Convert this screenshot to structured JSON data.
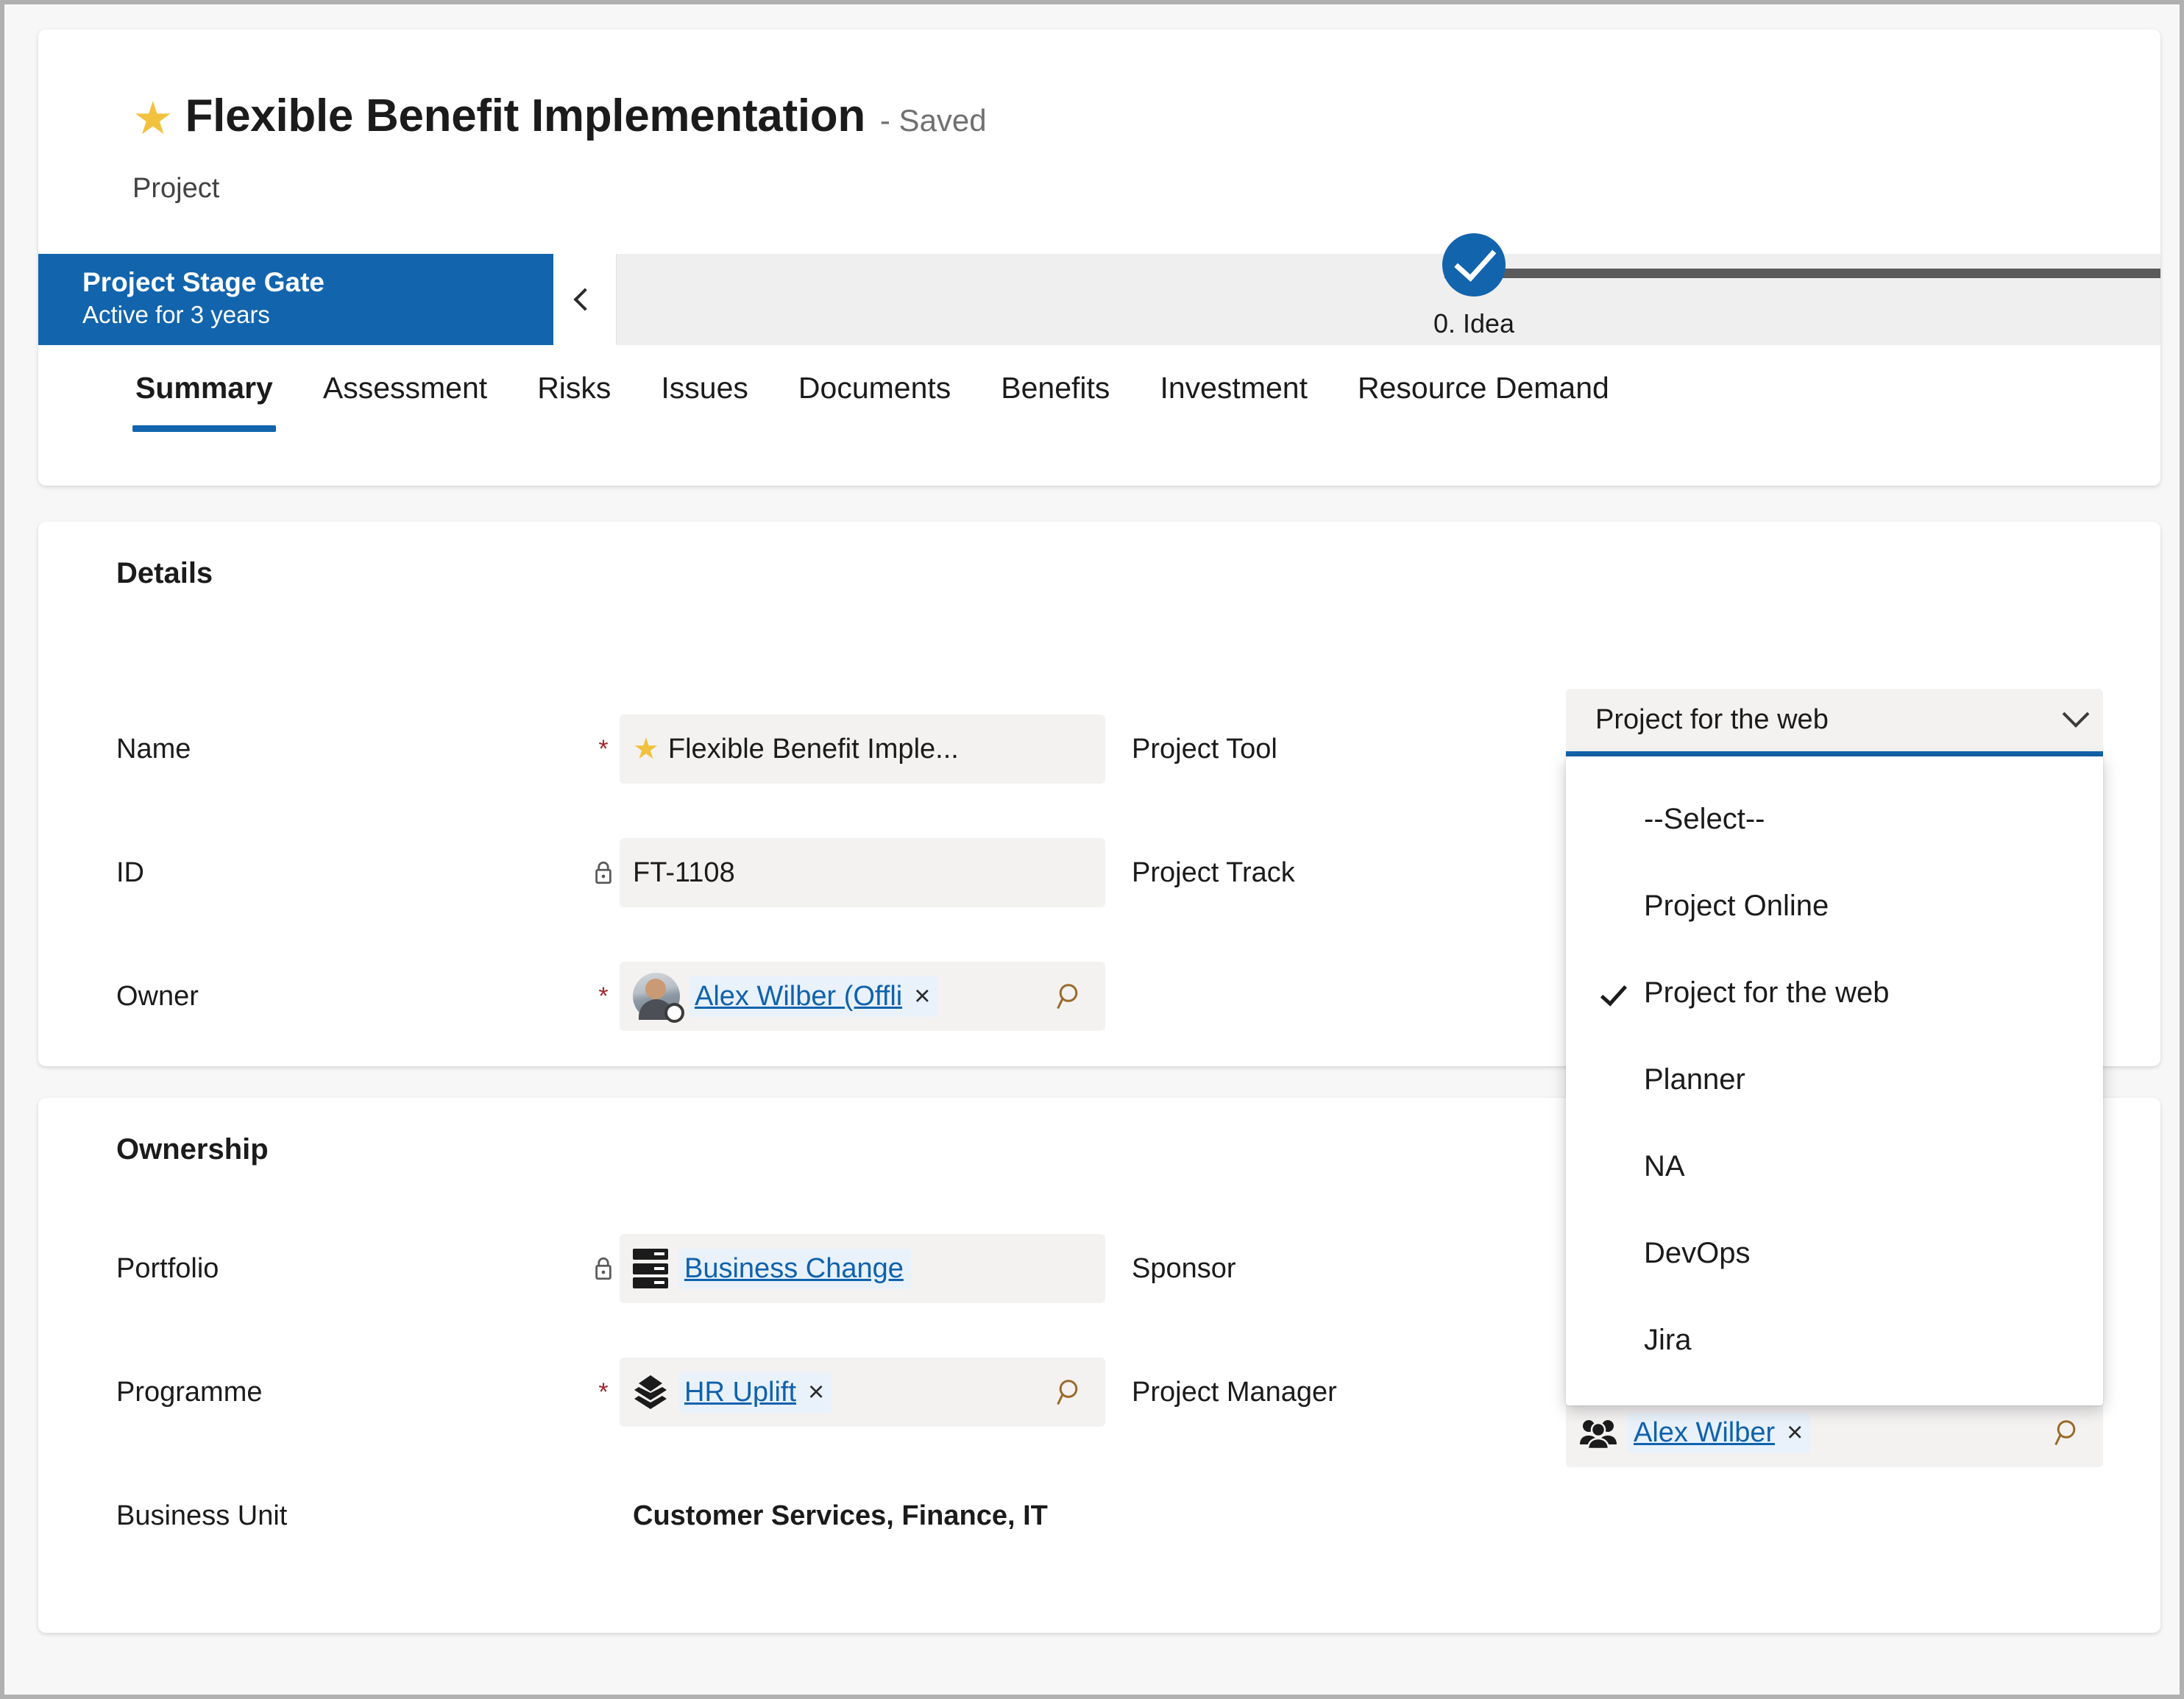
{
  "header": {
    "star_icon": "star-icon",
    "title": "Flexible Benefit Implementation",
    "saved_status": "- Saved",
    "entity_label": "Project"
  },
  "business_process": {
    "name": "Project Stage Gate",
    "active_for": "Active for 3 years",
    "collapse_icon": "chevron-left-icon",
    "stages": [
      {
        "label": "0. Idea",
        "completed": true
      }
    ]
  },
  "tabs": [
    {
      "label": "Summary",
      "active": true
    },
    {
      "label": "Assessment",
      "active": false
    },
    {
      "label": "Risks",
      "active": false
    },
    {
      "label": "Issues",
      "active": false
    },
    {
      "label": "Documents",
      "active": false
    },
    {
      "label": "Benefits",
      "active": false
    },
    {
      "label": "Investment",
      "active": false
    },
    {
      "label": "Resource Demand",
      "active": false
    }
  ],
  "details": {
    "title": "Details",
    "name": {
      "label": "Name",
      "required_marker": "*",
      "value": "Flexible Benefit Imple...",
      "icon": "star-icon"
    },
    "id": {
      "label": "ID",
      "lock_icon": "lock-icon",
      "value": "FT-1108"
    },
    "owner": {
      "label": "Owner",
      "required_marker": "*",
      "value": "Alex Wilber (Offli",
      "remove_label": "×",
      "search_icon": "search-icon",
      "avatar": "avatar"
    },
    "project_tool": {
      "label": "Project Tool",
      "value": "Project for the web",
      "chevron_icon": "chevron-down-icon",
      "options": [
        {
          "label": "--Select--",
          "selected": false
        },
        {
          "label": "Project Online",
          "selected": false
        },
        {
          "label": "Project for the web",
          "selected": true
        },
        {
          "label": "Planner",
          "selected": false
        },
        {
          "label": "NA",
          "selected": false
        },
        {
          "label": "DevOps",
          "selected": false
        },
        {
          "label": "Jira",
          "selected": false
        }
      ]
    },
    "project_track": {
      "label": "Project Track",
      "value": ""
    }
  },
  "ownership": {
    "title": "Ownership",
    "portfolio": {
      "label": "Portfolio",
      "lock_icon": "lock-icon",
      "value": "Business Change",
      "icon": "server-rack-icon"
    },
    "programme": {
      "label": "Programme",
      "required_marker": "*",
      "value": "HR Uplift",
      "remove_label": "×",
      "search_icon": "search-icon",
      "icon": "layers-icon"
    },
    "business_unit": {
      "label": "Business Unit",
      "value": "Customer Services, Finance, IT"
    },
    "sponsor": {
      "label": "Sponsor",
      "value": ""
    },
    "project_manager": {
      "label": "Project Manager",
      "value": "Alex Wilber",
      "remove_label": "×",
      "search_icon": "search-icon",
      "icon": "people-icon"
    }
  },
  "colors": {
    "accent": "#1264ad",
    "star": "#f2c13d",
    "link": "#0f62ad",
    "required": "#a4262c",
    "field_bg": "#f3f2f1",
    "chip_bg": "#e9f1fb"
  }
}
